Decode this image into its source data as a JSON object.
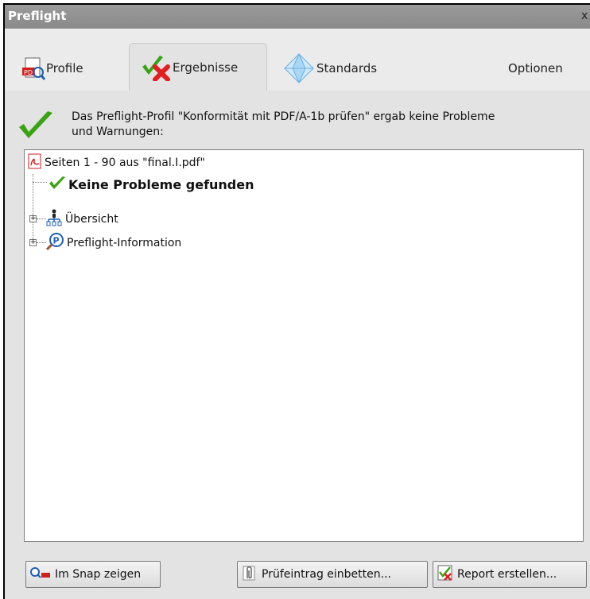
{
  "window": {
    "title": "Preflight",
    "close_label": "x"
  },
  "tabs": [
    {
      "label": "Profile"
    },
    {
      "label": "Ergebnisse"
    },
    {
      "label": "Standards"
    }
  ],
  "options_label": "Optionen",
  "message": {
    "line1": "Das Preflight-Profil \"Konformität mit PDF/A-1b prüfen\" ergab keine Probleme",
    "line2": "und Warnungen:"
  },
  "tree": {
    "root": "Seiten 1 - 90 aus \"final.I.pdf\"",
    "result": "Keine Probleme gefunden",
    "overview": "Übersicht",
    "info": "Preflight-Information"
  },
  "buttons": {
    "snap": "Im Snap zeigen",
    "embed": "Prüfeintrag einbetten...",
    "report": "Report erstellen..."
  },
  "colors": {
    "check_green": "#3aa312",
    "cross_red": "#e02020",
    "pdf_red": "#d01f1f",
    "window_gray": "#e3e3e3"
  }
}
